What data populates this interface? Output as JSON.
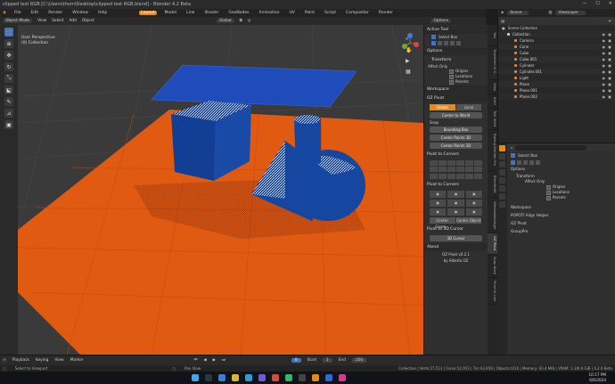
{
  "window": {
    "title": "clipped test RGB [C:\\Users\\thom\\Desktop\\clipped test RGB.blend] - Blender 4.2 Beta",
    "controls": [
      "—",
      "☐",
      "✕"
    ]
  },
  "menubar": {
    "menus": [
      "File",
      "Edit",
      "Render",
      "Window",
      "Help"
    ],
    "workspaces": [
      "Layout",
      "Model",
      "Line",
      "Shader",
      "GeoNodes",
      "Animation",
      "UV",
      "Paint",
      "Script",
      "Compositor",
      "Render"
    ],
    "active_workspace": "Layout",
    "scene_label": "Scene",
    "viewlayer_label": "ViewLayer"
  },
  "header": {
    "mode": "Object Mode",
    "menus": [
      "View",
      "Select",
      "Add",
      "Object"
    ],
    "orientation": "Global",
    "options": "Options"
  },
  "viewport": {
    "info_line1": "User Perspective",
    "info_line2": "(0) Collection"
  },
  "sidebar": {
    "active_tool_title": "Active Tool",
    "select_box": "Select Box",
    "options_title": "Options",
    "transform_title": "Transform",
    "affect_only": "Affect Only",
    "origins": "Origins",
    "locations": "Locations",
    "parents": "Parents",
    "workspace_title": "Workspace",
    "oz_pivot_title": "OZ Pivot",
    "global": "Global",
    "local": "Local",
    "center_to_world": "Center to World",
    "snap_title": "Snap",
    "bounding_box": "Bounding Box",
    "center_points_3d": "Center Points 3D",
    "center_points_2d": "Center Points 2D",
    "pivot_to_corners": "Pivot to Corners",
    "pivot_to_corners_b": "Pivot to Corners",
    "center_geometry": "Center Geom...",
    "center_object": "Center Object",
    "pivot_3d_cursor": "Pivot to 3D Cursor",
    "cursor_3d": "3D Cursor",
    "about_title": "About",
    "version": "OZ Pivot v0.2.1",
    "author": "by Alberto OZ"
  },
  "side_tabs": [
    "Tool",
    "Transform & O...",
    "View",
    "Item",
    "Tool Shelf",
    "Baking Blender Pro",
    "BlenderKit",
    "WindowManager",
    "OZ Pivot",
    "Snap Base",
    "Pivot to Line"
  ],
  "outliner": {
    "title": "Scene Collection",
    "items": [
      {
        "name": "Collection",
        "indent": 0
      },
      {
        "name": "Camera",
        "indent": 1
      },
      {
        "name": "Cone",
        "indent": 1
      },
      {
        "name": "Cube",
        "indent": 1
      },
      {
        "name": "Cube.001",
        "indent": 1
      },
      {
        "name": "Cylinder",
        "indent": 1
      },
      {
        "name": "Cylinder.001",
        "indent": 1
      },
      {
        "name": "Light",
        "indent": 1
      },
      {
        "name": "Plane",
        "indent": 1
      },
      {
        "name": "Plane.001",
        "indent": 1
      },
      {
        "name": "Plane.002",
        "indent": 1
      }
    ]
  },
  "properties": {
    "select_box": "Select Box",
    "options": "Options",
    "transform": "Transform",
    "affect_only": "Affect Only",
    "origins": "Origins",
    "locations": "Locations",
    "parents": "Parents",
    "workspace": "Workspace",
    "popoti": "POPOTI Align Helper",
    "oz_pivot": "OZ Pivot",
    "grouppro": "GroupPro"
  },
  "timeline": {
    "items": [
      "Playback",
      "Keying",
      "View",
      "Marker"
    ],
    "current_frame": "0",
    "start_label": "Start",
    "start": "1",
    "end_label": "End",
    "end": "250"
  },
  "status": {
    "left": "Select to Viewport",
    "middle": "Pan View",
    "right": "Collection | Verts:27,513 | Faces:52,953 | Tris:43,958 | Objects:0/10 | Memory: 63.4 MiB | VRAM: 1.3/6.0 GiB | 4.2.0 Beta"
  },
  "clock": {
    "time": "10:17 PM",
    "date": "6/6/2024"
  },
  "colors": {
    "accent": "#e58a1a",
    "blue": "#4772b3",
    "floor": "#e05a12",
    "object_blue": "#1546a0"
  }
}
